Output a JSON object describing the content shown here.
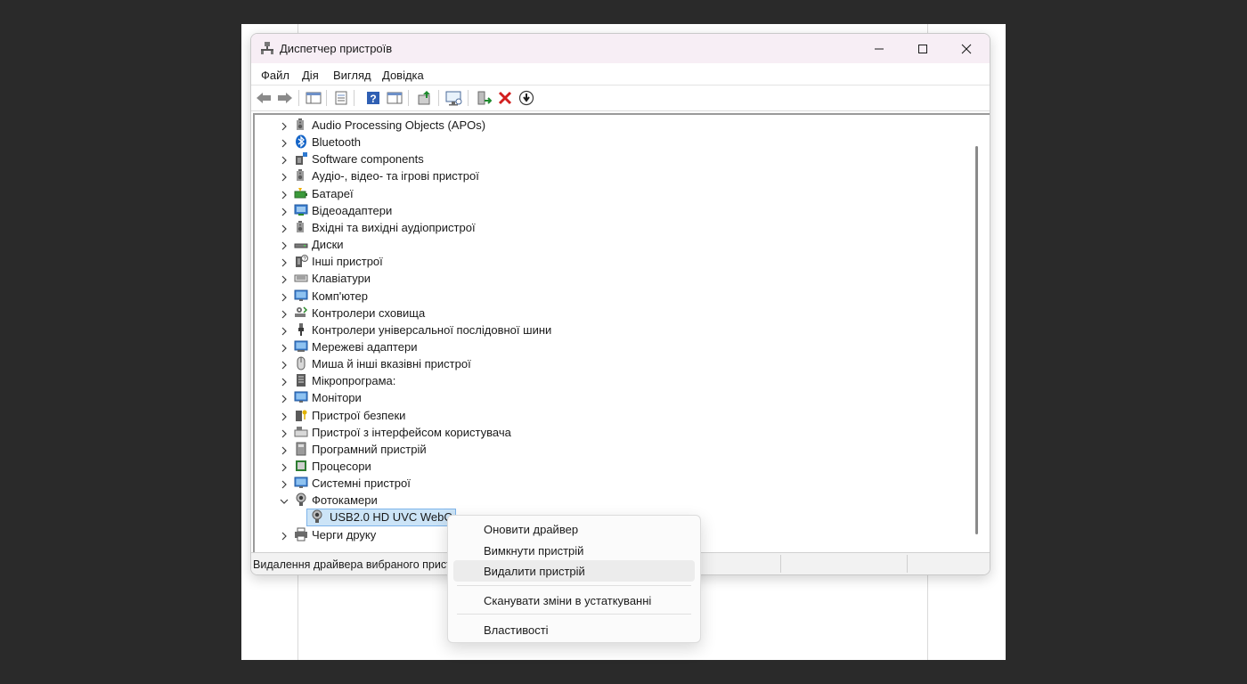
{
  "window": {
    "title": "Диспетчер пристроїв"
  },
  "menubar": {
    "items": [
      "Файл",
      "Дія",
      "Вигляд",
      "Довідка"
    ]
  },
  "toolbar": {
    "icons": [
      "back-icon",
      "forward-icon",
      "show-hide-console-tree-icon",
      "properties-icon",
      "help-icon",
      "action-pane-icon",
      "update-driver-icon",
      "scan-hardware-icon",
      "enable-device-icon",
      "uninstall-device-icon",
      "download-driver-icon"
    ],
    "accent_red": "#d21f1f",
    "accent_green": "#1e8a2e"
  },
  "tree": {
    "categories": [
      {
        "label": "Audio Processing Objects (APOs)",
        "icon": "speaker-icon",
        "expanded": false
      },
      {
        "label": "Bluetooth",
        "icon": "bluetooth-icon",
        "expanded": false
      },
      {
        "label": "Software components",
        "icon": "software-component-icon",
        "expanded": false
      },
      {
        "label": "Аудіо-, відео- та ігрові пристрої",
        "icon": "speaker-icon",
        "expanded": false
      },
      {
        "label": "Батареї",
        "icon": "battery-icon",
        "expanded": false
      },
      {
        "label": "Відеоадаптери",
        "icon": "display-adapter-icon",
        "expanded": false
      },
      {
        "label": "Вхідні та вихідні аудіопристрої",
        "icon": "speaker-icon",
        "expanded": false
      },
      {
        "label": "Диски",
        "icon": "disk-drive-icon",
        "expanded": false
      },
      {
        "label": "Інші пристрої",
        "icon": "unknown-device-icon",
        "expanded": false
      },
      {
        "label": "Клавіатури",
        "icon": "keyboard-icon",
        "expanded": false
      },
      {
        "label": "Комп'ютер",
        "icon": "computer-icon",
        "expanded": false
      },
      {
        "label": "Контролери сховища",
        "icon": "storage-controller-icon",
        "expanded": false
      },
      {
        "label": "Контролери універсальної послідовної шини",
        "icon": "usb-icon",
        "expanded": false
      },
      {
        "label": "Мережеві адаптери",
        "icon": "network-adapter-icon",
        "expanded": false
      },
      {
        "label": "Миша й інші вказівні пристрої",
        "icon": "mouse-icon",
        "expanded": false
      },
      {
        "label": "Мікропрограма:",
        "icon": "firmware-icon",
        "expanded": false
      },
      {
        "label": "Монітори",
        "icon": "monitor-icon",
        "expanded": false
      },
      {
        "label": "Пристрої безпеки",
        "icon": "security-key-icon",
        "expanded": false
      },
      {
        "label": "Пристрої з інтерфейсом користувача",
        "icon": "hid-icon",
        "expanded": false
      },
      {
        "label": "Програмний пристрій",
        "icon": "software-device-icon",
        "expanded": false
      },
      {
        "label": "Процесори",
        "icon": "processor-icon",
        "expanded": false
      },
      {
        "label": "Системні пристрої",
        "icon": "system-device-icon",
        "expanded": false
      },
      {
        "label": "Фотокамери",
        "icon": "camera-icon",
        "expanded": true
      }
    ],
    "selected_child": {
      "label": "USB2.0 HD UVC WebCam",
      "icon": "webcam-icon"
    },
    "after": {
      "label": "Черги друку",
      "icon": "printer-icon",
      "expanded": false
    }
  },
  "statusbar": {
    "text": "Видалення драйвера вибраного пристрою."
  },
  "context_menu": {
    "items": [
      "Оновити драйвер",
      "Вимкнути пристрій",
      "Видалити пристрій",
      "Сканувати зміни в устаткуванні",
      "Властивості"
    ],
    "hovered": "Видалити пристрій"
  }
}
